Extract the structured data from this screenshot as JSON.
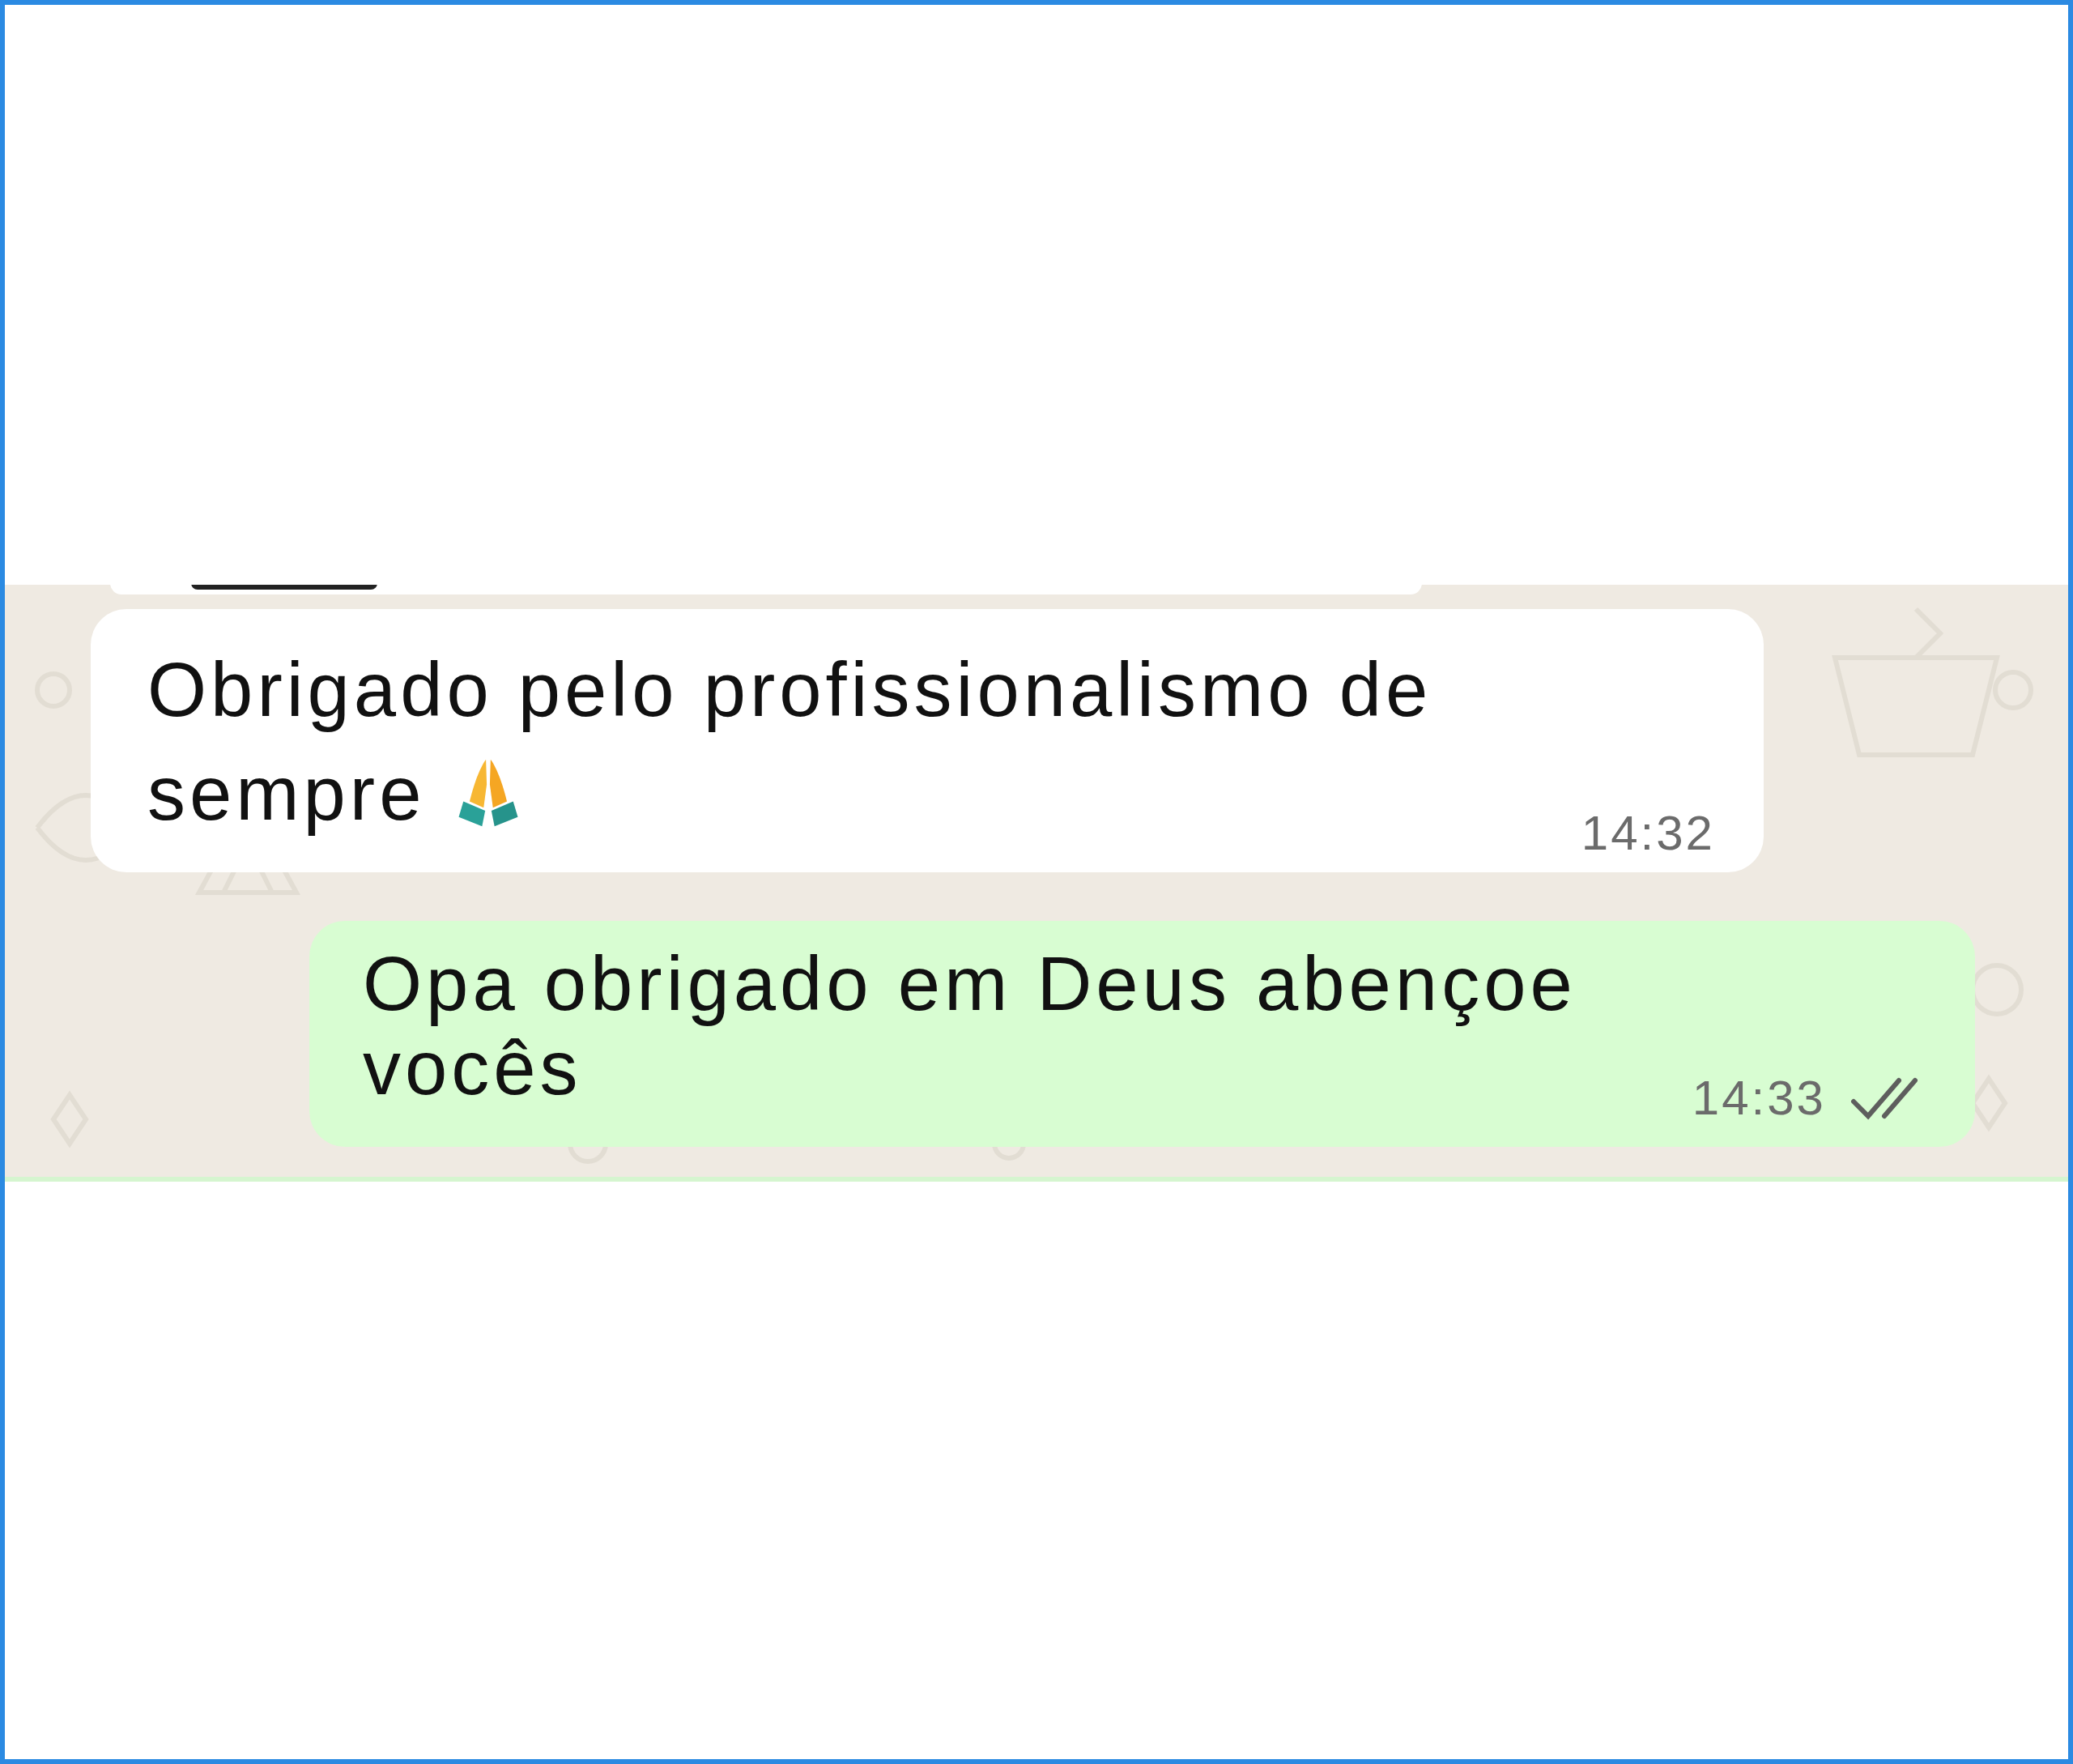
{
  "messages": [
    {
      "outgoing": false,
      "text": "Obrigado pelo profissionalismo de sempre",
      "emoji": true,
      "time": "14:32"
    },
    {
      "outgoing": true,
      "text": "Opa obrigado em Deus abençoe vocês",
      "time": "14:33",
      "read": false
    }
  ]
}
